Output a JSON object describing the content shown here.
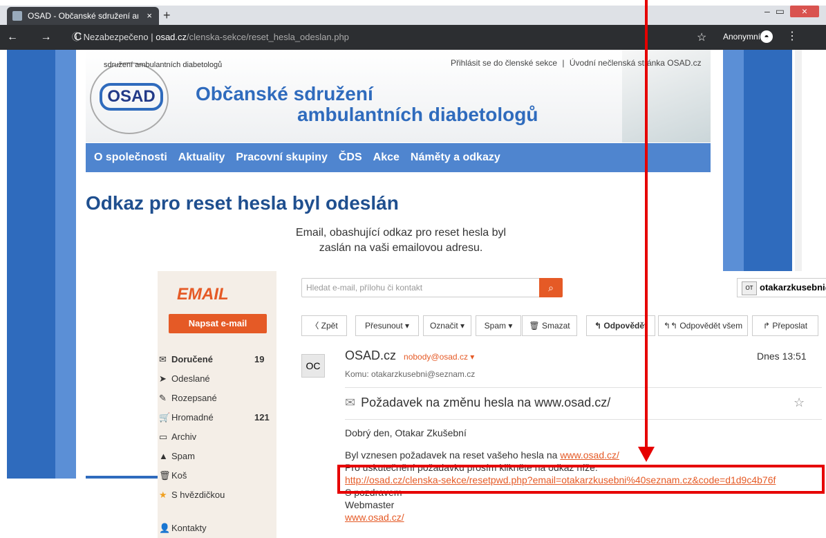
{
  "browser": {
    "tab_title": "OSAD - Občanské sdružení ambul",
    "tab_close": "×",
    "new_tab": "+",
    "nav_icons": "← → C",
    "security": "ⓘ Nezabezpečeno",
    "separator": "|",
    "url_host": "osad.cz",
    "url_path": "/clenska-sekce/reset_hesla_odeslan.php",
    "anon_label": "Anonymní",
    "win_min": "–",
    "win_max": "▭",
    "win_close": "×",
    "menu": "⋮",
    "star": "☆"
  },
  "site": {
    "logo_text": "OSAD",
    "logo_ring": "sdružení ambulantních diabetologů",
    "title_line1": "Občanské sdružení",
    "title_line2": "ambulantních diabetologů",
    "toplinks": [
      "Přihlásit se do členské sekce",
      "|",
      "Úvodní nečlenská stránka OSAD.cz"
    ],
    "nav": [
      "O společnosti",
      "Aktuality",
      "Pracovní skupiny",
      "ČDS",
      "Akce",
      "Náměty a odkazy"
    ],
    "heading": "Odkaz pro reset hesla byl odeslán",
    "message_line1": "Email, obashující odkaz pro reset hesla byl",
    "message_line2": "zaslán na vaši emailovou adresu."
  },
  "email": {
    "logo": "EMAIL",
    "compose": "Napsat e-mail",
    "search_placeholder": "Hledat e-mail, přílohu či kontakt",
    "search_icon": "⌕",
    "user_avatar": "OT",
    "user_email": "otakarzkusebni@",
    "folders": [
      {
        "icon": "✉",
        "label": "Doručené",
        "count": "19"
      },
      {
        "icon": "➤",
        "label": "Odeslané",
        "count": ""
      },
      {
        "icon": "✎",
        "label": "Rozepsané",
        "count": ""
      },
      {
        "icon": "🛒",
        "label": "Hromadné",
        "count": "121"
      },
      {
        "icon": "▭",
        "label": "Archiv",
        "count": ""
      },
      {
        "icon": "▲",
        "label": "Spam",
        "count": ""
      },
      {
        "icon": "🗑",
        "label": "Koš",
        "count": ""
      },
      {
        "icon": "★",
        "label": "S hvězdičkou",
        "count": ""
      },
      {
        "icon": "👤",
        "label": "Kontakty",
        "count": ""
      }
    ],
    "toolbar": {
      "back": "〈 Zpět",
      "move": "Přesunout ▾",
      "mark": "Označit ▾",
      "spam": "Spam ▾",
      "delete": "🗑 Smazat",
      "reply": "↰ Odpovědět",
      "reply_all": "↰↰ Odpovědět všem",
      "forward": "↱ Přeposlat"
    },
    "message": {
      "avatar": "OC",
      "sender": "OSAD.cz",
      "sender_email": "nobody@osad.cz ▾",
      "to": "Komu: otakarzkusebni@seznam.cz",
      "date": "Dnes 13:51",
      "subject_icon": "✉",
      "subject": "Požadavek na změnu hesla na www.osad.cz/",
      "greeting": "Dobrý den, Otakar Zkušební",
      "line1": "Byl vznesen požadavek na reset vašeho hesla na",
      "line1_link": "www.osad.cz/",
      "line2": "Pro uskutečnění požadavku prosím klikněte na odkaz níže:",
      "reset_link": "http://osad.cz/clenska-sekce/resetpwd.php?email=otakarzkusebni%40seznam.cz&code=d1d9c4b76f",
      "regards": "S pozdravem",
      "signature": "Webmaster",
      "signature_link": "www.osad.cz/"
    }
  },
  "colors": {
    "site_blue": "#2f6bbd",
    "nav_blue": "#4f85cf",
    "email_orange": "#e55a26",
    "annotation_red": "#e60000"
  }
}
